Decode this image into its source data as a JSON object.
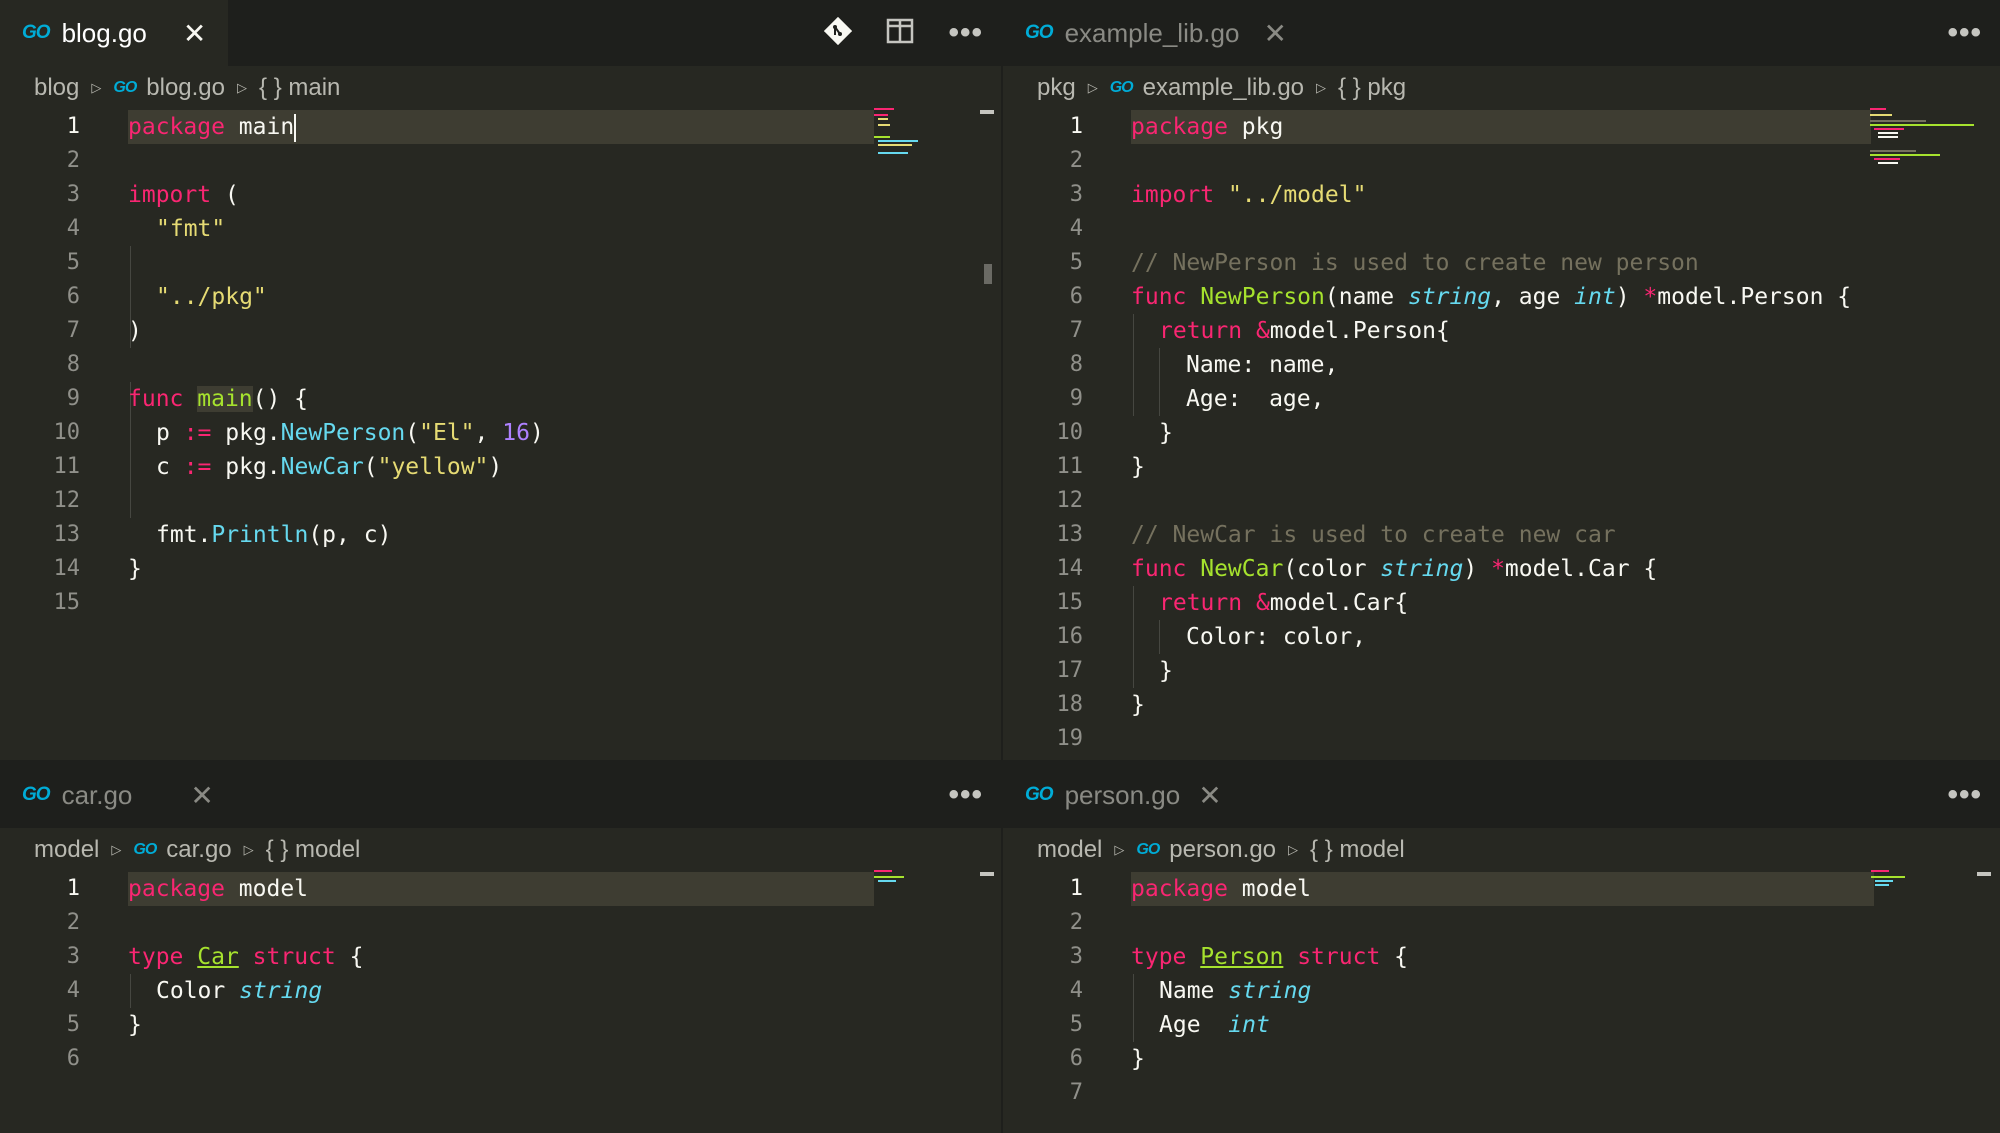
{
  "panes": {
    "blog": {
      "tab_label": "blog.go",
      "close_glyph": "✕",
      "go_icon_text": "GO",
      "breadcrumbs": [
        "blog",
        "blog.go",
        "{ } main"
      ],
      "lines": [
        "1",
        "2",
        "3",
        "4",
        "5",
        "6",
        "7",
        "8",
        "9",
        "10",
        "11",
        "12",
        "13",
        "14",
        "15"
      ],
      "code": {
        "l1a": "package",
        "l1b": " main",
        "l3a": "import",
        "l3b": " (",
        "l4": "\"fmt\"",
        "l6": "\"../pkg\"",
        "l7": ")",
        "l9a": "func",
        "l9b": "main",
        "l9c": "() {",
        "l10a": "p ",
        "l10b": ":=",
        "l10c": " pkg.",
        "l10d": "NewPerson",
        "l10e": "(",
        "l10f": "\"El\"",
        "l10g": ", ",
        "l10h": "16",
        "l10i": ")",
        "l11a": "c ",
        "l11b": ":=",
        "l11c": " pkg.",
        "l11d": "NewCar",
        "l11e": "(",
        "l11f": "\"yellow\"",
        "l11g": ")",
        "l13a": "fmt.",
        "l13b": "Println",
        "l13c": "(p, c)",
        "l14": "}"
      }
    },
    "example": {
      "tab_label": "example_lib.go",
      "close_glyph": "✕",
      "go_icon_text": "GO",
      "breadcrumbs": [
        "pkg",
        "example_lib.go",
        "{ } pkg"
      ],
      "lines": [
        "1",
        "2",
        "3",
        "4",
        "5",
        "6",
        "7",
        "8",
        "9",
        "10",
        "11",
        "12",
        "13",
        "14",
        "15",
        "16",
        "17",
        "18",
        "19"
      ],
      "code": {
        "l1a": "package",
        "l1b": " pkg",
        "l3a": "import",
        "l3b": " \"../model\"",
        "l5": "// NewPerson is used to create new person",
        "l6a": "func",
        "l6b": " NewPerson",
        "l6c": "(name ",
        "l6d": "string",
        "l6e": ", age ",
        "l6f": "int",
        "l6g": ") ",
        "l6h": "*",
        "l6i": "model.Person {",
        "l7a": "return",
        "l7b": " &",
        "l7c": "model.Person{",
        "l8": "Name: name,",
        "l9": "Age:  age,",
        "l10": "}",
        "l11": "}",
        "l13": "// NewCar is used to create new car",
        "l14a": "func",
        "l14b": " NewCar",
        "l14c": "(color ",
        "l14d": "string",
        "l14e": ") ",
        "l14f": "*",
        "l14g": "model.Car {",
        "l15a": "return",
        "l15b": " &",
        "l15c": "model.Car{",
        "l16": "Color: color,",
        "l17": "}",
        "l18": "}"
      }
    },
    "car": {
      "tab_label": "car.go",
      "close_glyph": "✕",
      "go_icon_text": "GO",
      "breadcrumbs": [
        "model",
        "car.go",
        "{ } model"
      ],
      "lines": [
        "1",
        "2",
        "3",
        "4",
        "5",
        "6"
      ],
      "code": {
        "l1a": "package",
        "l1b": " model",
        "l3a": "type",
        "l3b": "Car",
        "l3c": "struct",
        "l3d": " {",
        "l4a": "Color ",
        "l4b": "string",
        "l5": "}"
      }
    },
    "person": {
      "tab_label": "person.go",
      "close_glyph": "✕",
      "go_icon_text": "GO",
      "breadcrumbs": [
        "model",
        "person.go",
        "{ } model"
      ],
      "lines": [
        "1",
        "2",
        "3",
        "4",
        "5",
        "6",
        "7"
      ],
      "code": {
        "l1a": "package",
        "l1b": " model",
        "l3a": "type",
        "l3b": "Person",
        "l3c": "struct",
        "l3d": " {",
        "l4a": "Name ",
        "l4b": "string",
        "l5a": "Age  ",
        "l5b": "int",
        "l6": "}"
      }
    }
  },
  "toolbar": {
    "more_glyph": "•••"
  },
  "colors": {
    "background": "#272822",
    "keyword": "#f92672",
    "string": "#e6db74",
    "function": "#a6e22e",
    "type": "#66d9ef",
    "number": "#ae81ff",
    "comment": "#75715e"
  }
}
